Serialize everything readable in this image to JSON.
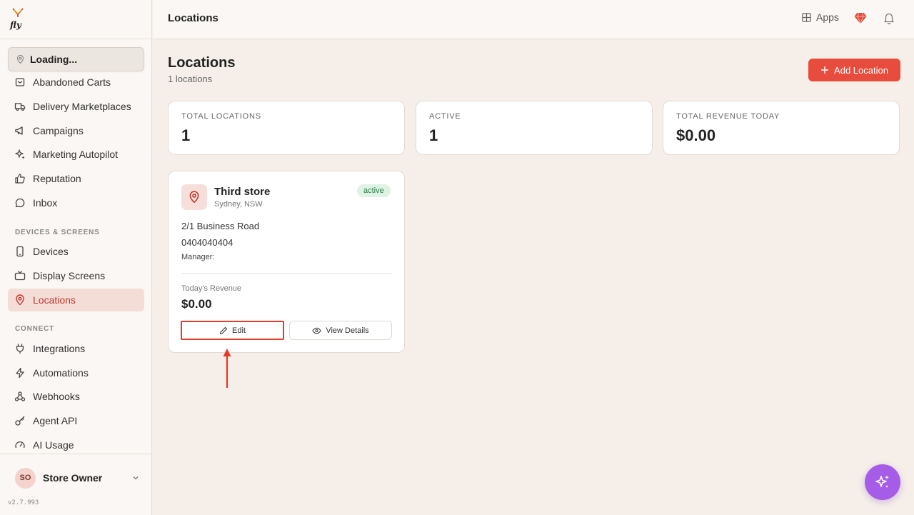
{
  "sidebar": {
    "location_selector": "Loading...",
    "items_top": [
      {
        "label": "Abandoned Carts",
        "icon": "cart-box-icon"
      },
      {
        "label": "Delivery Marketplaces",
        "icon": "truck-icon"
      },
      {
        "label": "Campaigns",
        "icon": "megaphone-icon"
      },
      {
        "label": "Marketing Autopilot",
        "icon": "sparkles-icon"
      },
      {
        "label": "Reputation",
        "icon": "thumbs-up-icon"
      },
      {
        "label": "Inbox",
        "icon": "chat-bubble-icon"
      }
    ],
    "section_devices": "DEVICES & SCREENS",
    "items_devices": [
      {
        "label": "Devices",
        "icon": "tablet-icon"
      },
      {
        "label": "Display Screens",
        "icon": "tv-icon"
      },
      {
        "label": "Locations",
        "icon": "map-pin-icon",
        "active": true
      }
    ],
    "section_connect": "CONNECT",
    "items_connect": [
      {
        "label": "Integrations",
        "icon": "plug-icon"
      },
      {
        "label": "Automations",
        "icon": "lightning-icon"
      },
      {
        "label": "Webhooks",
        "icon": "webhook-icon"
      },
      {
        "label": "Agent API",
        "icon": "key-icon"
      },
      {
        "label": "AI Usage",
        "icon": "gauge-icon"
      }
    ],
    "user": {
      "initials": "SO",
      "name": "Store Owner"
    },
    "version": "v2.7.993"
  },
  "topbar": {
    "title": "Locations",
    "apps_label": "Apps"
  },
  "main": {
    "title": "Locations",
    "subtitle": "1 locations",
    "add_button": "Add Location",
    "stats": [
      {
        "label": "TOTAL LOCATIONS",
        "value": "1"
      },
      {
        "label": "ACTIVE",
        "value": "1"
      },
      {
        "label": "TOTAL REVENUE TODAY",
        "value": "$0.00"
      }
    ],
    "location_card": {
      "name": "Third store",
      "city": "Sydney, NSW",
      "status": "active",
      "address": "2/1 Business Road",
      "phone": "0404040404",
      "manager": "Manager:",
      "revenue_label": "Today's Revenue",
      "revenue_value": "$0.00",
      "edit_button": "Edit",
      "view_button": "View Details"
    }
  },
  "colors": {
    "accent": "#e74c3c",
    "active_badge_bg": "#def3e3",
    "ai_button": "#a55ce6",
    "annotation": "#e23b2a"
  }
}
